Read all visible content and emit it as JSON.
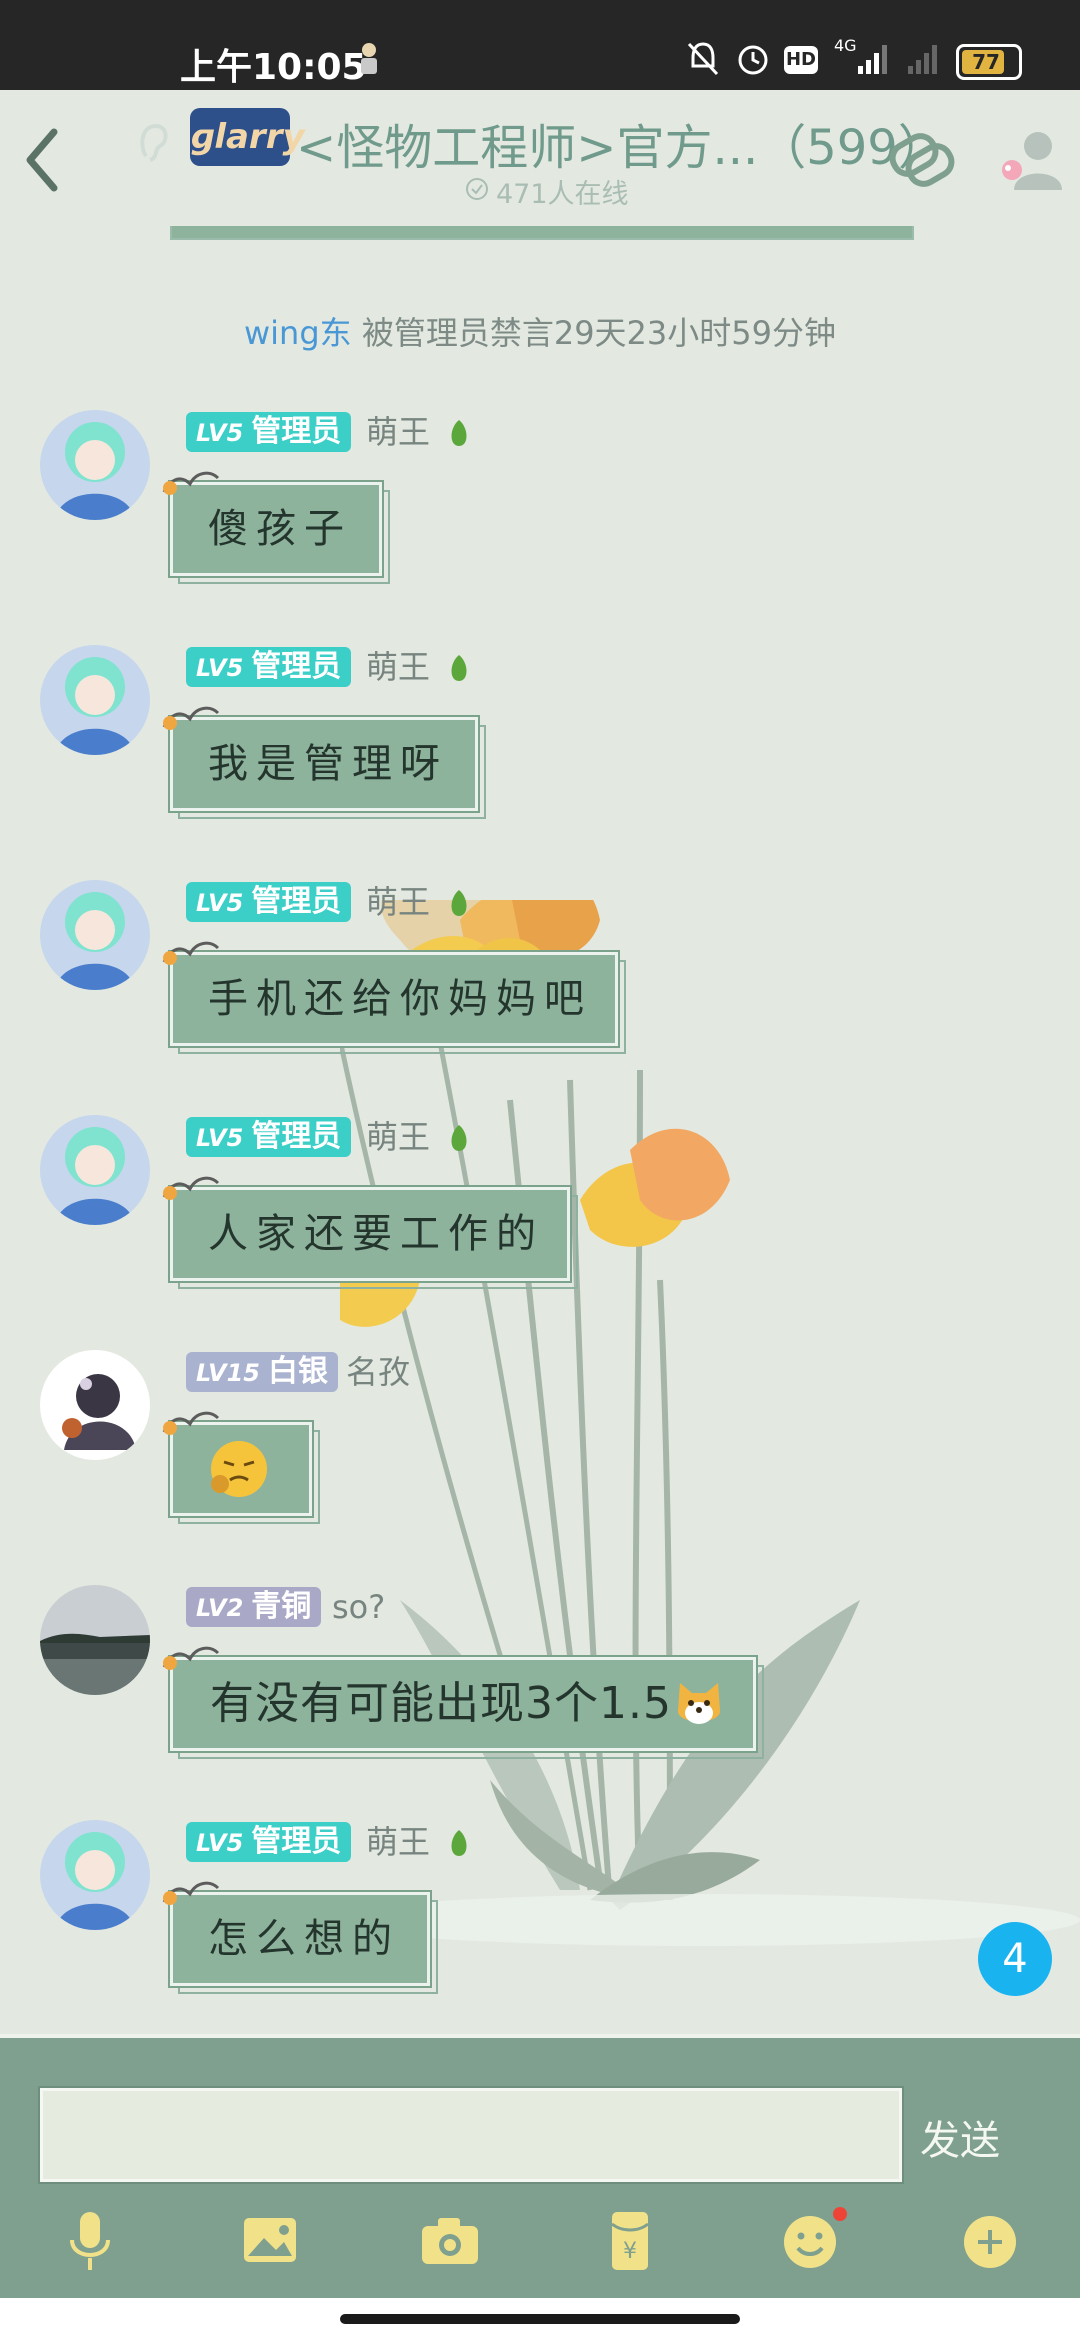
{
  "status_bar": {
    "time": "上午10:05",
    "network": "4G",
    "hd": "HD",
    "battery": "77"
  },
  "header": {
    "title": "<怪物工程师>官方...（599）",
    "online": "471人在线"
  },
  "system_message": {
    "user": "wing东",
    "text": " 被管理员禁言29天23小时59分钟"
  },
  "messages": [
    {
      "level": "LV5",
      "role": "管理员",
      "name": "萌王",
      "text": "傻孩子"
    },
    {
      "level": "LV5",
      "role": "管理员",
      "name": "萌王",
      "text": "我是管理呀"
    },
    {
      "level": "LV5",
      "role": "管理员",
      "name": "萌王",
      "text": "手机还给你妈妈吧"
    },
    {
      "level": "LV5",
      "role": "管理员",
      "name": "萌王",
      "text": "人家还要工作的"
    },
    {
      "level": "LV15",
      "role": "白银",
      "name": "名孜",
      "text": ""
    },
    {
      "level": "LV2",
      "role": "青铜",
      "name": "so?",
      "text": "有没有可能出现3个1.5"
    },
    {
      "level": "LV5",
      "role": "管理员",
      "name": "萌王",
      "text": "怎么想的"
    }
  ],
  "unread_count": "4",
  "composer": {
    "send_label": "发送",
    "input_value": ""
  },
  "toolbar_icons": [
    "microphone-icon",
    "image-icon",
    "camera-icon",
    "red-packet-icon",
    "emoji-icon",
    "plus-icon"
  ],
  "colors": {
    "accent": "#8db39c",
    "admin_tag": "#3ccfc8",
    "bottom_bar": "#7fa08f",
    "system_user": "#4a97d6",
    "unread_badge": "#19b3f0"
  }
}
